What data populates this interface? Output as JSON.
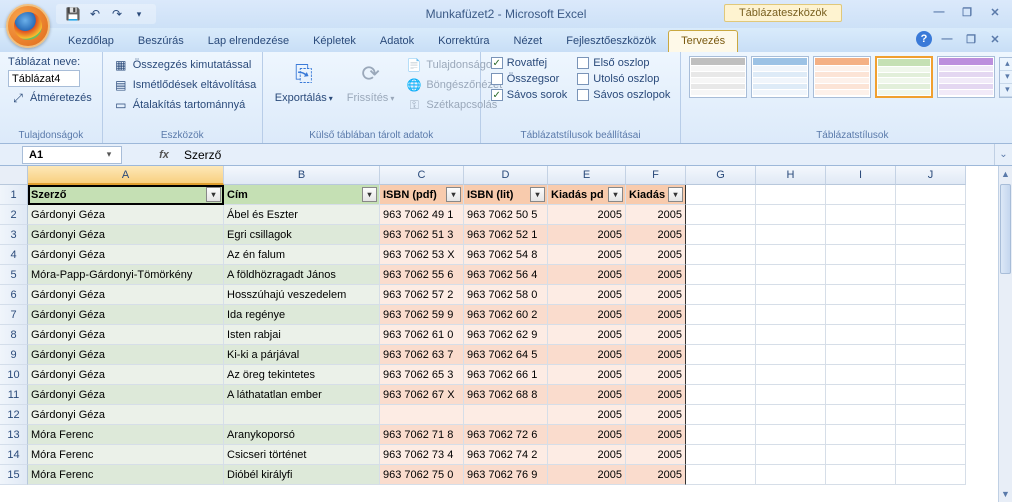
{
  "titlebar": {
    "title": "Munkafüzet2 - Microsoft Excel",
    "context_tab": "Táblázateszközök"
  },
  "ribbon": {
    "tabs": [
      "Kezdőlap",
      "Beszúrás",
      "Lap elrendezése",
      "Képletek",
      "Adatok",
      "Korrektúra",
      "Nézet",
      "Fejlesztőeszközök",
      "Tervezés"
    ],
    "active_tab": "Tervezés",
    "group_props": {
      "title": "Tulajdonságok",
      "name_label": "Táblázat neve:",
      "name_value": "Táblázat4",
      "resize": "Átméretezés"
    },
    "group_tools": {
      "title": "Eszközök",
      "pivot": "Összegzés kimutatással",
      "dedup": "Ismétlődések eltávolítása",
      "convert": "Átalakítás tartománnyá"
    },
    "group_ext": {
      "title": "Külső táblában tárolt adatok",
      "export": "Exportálás",
      "refresh": "Frissítés",
      "props": "Tulajdonságok",
      "browser": "Böngészőnézet",
      "unlink": "Szétkapcsolás"
    },
    "group_styleopts": {
      "title": "Táblázatstílusok beállításai",
      "header_row": "Rovatfej",
      "total_row": "Összegsor",
      "banded_rows": "Sávos sorok",
      "first_col": "Első oszlop",
      "last_col": "Utolsó oszlop",
      "banded_cols": "Sávos oszlopok"
    },
    "group_styles": {
      "title": "Táblázatstílusok"
    }
  },
  "namebox": "A1",
  "formula": "Szerző",
  "columns": [
    "A",
    "B",
    "C",
    "D",
    "E",
    "F",
    "G",
    "H",
    "I",
    "J"
  ],
  "table": {
    "headers": [
      "Szerző",
      "Cím",
      "ISBN  (pdf)",
      "ISBN (lit)",
      "Kiadás pd",
      "Kiadás li"
    ],
    "rows": [
      {
        "a": "Gárdonyi Géza",
        "b": "Ábel és Eszter",
        "c": "963 7062 49 1",
        "d": "963 7062 50 5",
        "e": "2005",
        "f": "2005"
      },
      {
        "a": "Gárdonyi Géza",
        "b": "Egri csillagok",
        "c": "963 7062 51 3",
        "d": "963 7062 52 1",
        "e": "2005",
        "f": "2005"
      },
      {
        "a": "Gárdonyi Géza",
        "b": "Az én falum",
        "c": "963 7062 53 X",
        "d": "963 7062 54 8",
        "e": "2005",
        "f": "2005"
      },
      {
        "a": "Móra-Papp-Gárdonyi-Tömörkény",
        "b": "A földhözragadt János",
        "c": "963 7062 55 6",
        "d": "963 7062 56 4",
        "e": "2005",
        "f": "2005"
      },
      {
        "a": "Gárdonyi Géza",
        "b": "Hosszúhajú veszedelem",
        "c": "963 7062 57 2",
        "d": "963 7062 58 0",
        "e": "2005",
        "f": "2005"
      },
      {
        "a": "Gárdonyi Géza",
        "b": "Ida regénye",
        "c": "963 7062 59 9",
        "d": "963 7062 60 2",
        "e": "2005",
        "f": "2005"
      },
      {
        "a": "Gárdonyi Géza",
        "b": "Isten rabjai",
        "c": "963 7062 61 0",
        "d": "963 7062 62 9",
        "e": "2005",
        "f": "2005"
      },
      {
        "a": "Gárdonyi Géza",
        "b": "Ki-ki a párjával",
        "c": "963 7062 63 7",
        "d": "963 7062 64 5",
        "e": "2005",
        "f": "2005"
      },
      {
        "a": "Gárdonyi Géza",
        "b": "Az öreg tekintetes",
        "c": "963 7062 65 3",
        "d": "963 7062 66 1",
        "e": "2005",
        "f": "2005"
      },
      {
        "a": "Gárdonyi Géza",
        "b": "A láthatatlan ember",
        "c": "963 7062 67 X",
        "d": "963 7062 68 8",
        "e": "2005",
        "f": "2005"
      },
      {
        "a": "Gárdonyi Géza",
        "b": "",
        "c": "",
        "d": "",
        "e": "2005",
        "f": "2005"
      },
      {
        "a": "Móra Ferenc",
        "b": "Aranykoporsó",
        "c": "963 7062 71 8",
        "d": "963 7062 72 6",
        "e": "2005",
        "f": "2005"
      },
      {
        "a": "Móra Ferenc",
        "b": "Csicseri történet",
        "c": "963 7062 73 4",
        "d": "963 7062 74 2",
        "e": "2005",
        "f": "2005"
      },
      {
        "a": "Móra Ferenc",
        "b": "Dióbél királyfi",
        "c": "963 7062 75 0",
        "d": "963 7062 76 9",
        "e": "2005",
        "f": "2005"
      }
    ]
  },
  "style_thumbs": [
    {
      "hdr": "#bfbfbf",
      "even": "#e8e8e8",
      "odd": "#f6f6f6"
    },
    {
      "hdr": "#9cc2e5",
      "even": "#deebf7",
      "odd": "#f0f5fb"
    },
    {
      "hdr": "#f4b084",
      "even": "#fce4d6",
      "odd": "#fdf1ea"
    },
    {
      "hdr": "#c5e0b4",
      "even": "#e2efda",
      "odd": "#f0f7ec"
    },
    {
      "hdr": "#bc8fdd",
      "even": "#e4d7f1",
      "odd": "#f1eaf8"
    }
  ]
}
